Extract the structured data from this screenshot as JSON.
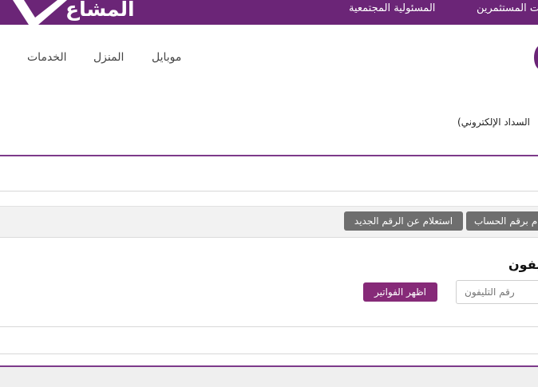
{
  "header": {
    "logo_text": "المشاع",
    "links": [
      "المسئولية المجتمعية",
      "ت المستثمرين"
    ],
    "brand_color": "#6b2577",
    "logo_icon": "brand-logo-icon"
  },
  "nav": {
    "items": [
      "الخدمات",
      "المنزل",
      "موبايل"
    ]
  },
  "page": {
    "subtitle": "(السداد الإلكتروني"
  },
  "tabs": {
    "new_number": "استعلام عن الرقم الجديد",
    "account_number": "م برقم الحساب"
  },
  "phone_form": {
    "heading": "يفون",
    "placeholder": "رقم التليفون",
    "submit_label": "اظهر الفواتير",
    "submit_color": "#862a78"
  }
}
